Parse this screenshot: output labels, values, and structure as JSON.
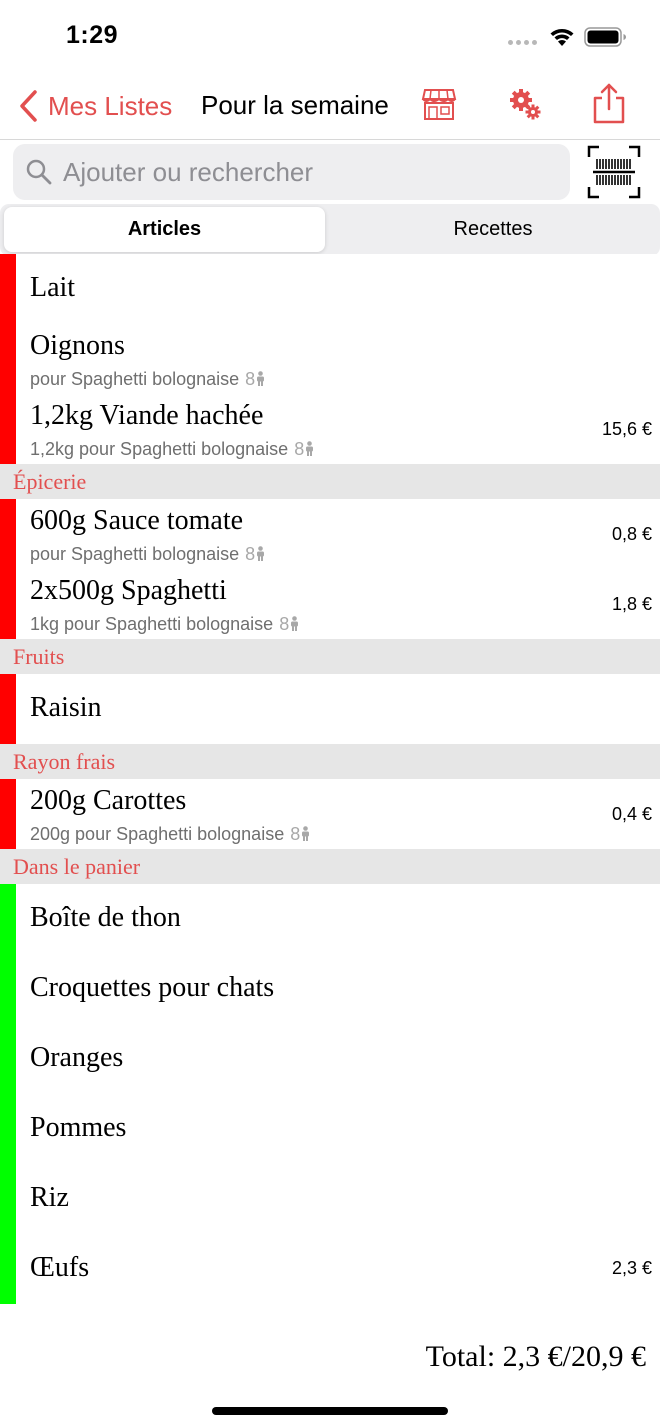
{
  "status": {
    "time": "1:29"
  },
  "nav": {
    "back_label": "Mes Listes",
    "title": "Pour la semaine",
    "icons": [
      "store-icon",
      "gears-icon",
      "share-icon"
    ]
  },
  "search": {
    "placeholder": "Ajouter ou rechercher",
    "value": ""
  },
  "tabs": [
    {
      "label": "Articles",
      "active": true
    },
    {
      "label": "Recettes",
      "active": false
    }
  ],
  "colors": {
    "accent": "#e24f4f",
    "pending": "#ff0000",
    "in_cart": "#00ff00",
    "header_bg": "#e6e6e6"
  },
  "groups": [
    {
      "header": "",
      "items": [
        {
          "name": "Lait",
          "sub": "",
          "people": "",
          "price": ""
        },
        {
          "name": "Oignons",
          "sub": "pour Spaghetti bolognaise",
          "people": "8",
          "price": ""
        },
        {
          "name": "1,2kg Viande hachée",
          "sub": "1,2kg pour Spaghetti bolognaise",
          "people": "8",
          "price": "15,6 €"
        }
      ]
    },
    {
      "header": "Épicerie",
      "items": [
        {
          "name": "600g Sauce tomate",
          "sub": "pour Spaghetti bolognaise",
          "people": "8",
          "price": "0,8 €"
        },
        {
          "name": "2x500g Spaghetti",
          "sub": "1kg pour Spaghetti bolognaise",
          "people": "8",
          "price": "1,8 €"
        }
      ]
    },
    {
      "header": "Fruits",
      "items": [
        {
          "name": "Raisin",
          "sub": "",
          "people": "",
          "price": ""
        }
      ]
    },
    {
      "header": "Rayon frais",
      "items": [
        {
          "name": "200g Carottes",
          "sub": "200g pour Spaghetti bolognaise",
          "people": "8",
          "price": "0,4 €"
        }
      ]
    },
    {
      "header": "Dans le panier",
      "in_cart": true,
      "items": [
        {
          "name": "Boîte de thon",
          "sub": "",
          "people": "",
          "price": ""
        },
        {
          "name": "Croquettes pour chats",
          "sub": "",
          "people": "",
          "price": ""
        },
        {
          "name": "Oranges",
          "sub": "",
          "people": "",
          "price": ""
        },
        {
          "name": "Pommes",
          "sub": "",
          "people": "",
          "price": ""
        },
        {
          "name": "Riz",
          "sub": "",
          "people": "",
          "price": ""
        },
        {
          "name": "Œufs",
          "sub": "",
          "people": "",
          "price": "2,3 €"
        }
      ]
    }
  ],
  "total": "Total: 2,3 €/20,9 €"
}
